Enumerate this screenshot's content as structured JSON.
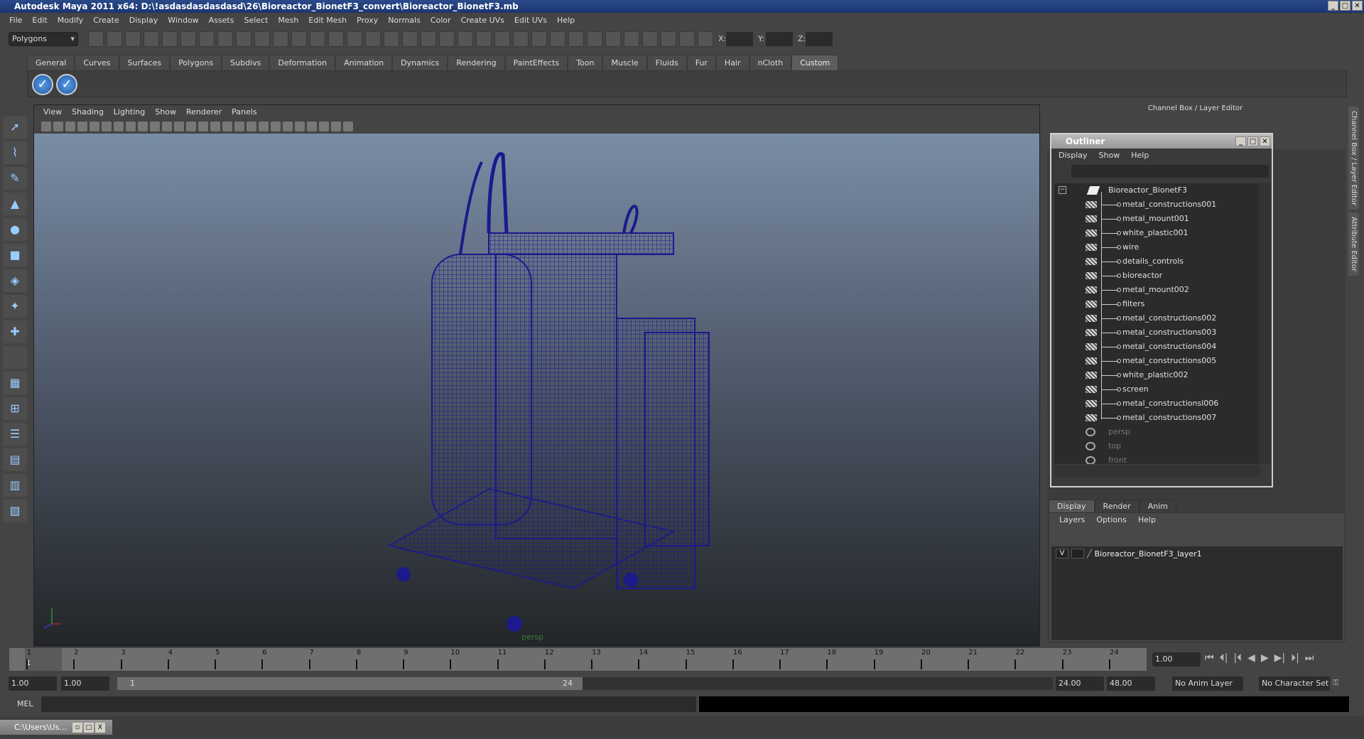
{
  "title": "Autodesk Maya 2011 x64: D:\\!asdasdasdasdasd\\26\\Bioreactor_BionetF3_convert\\Bioreactor_BionetF3.mb",
  "menu": [
    "File",
    "Edit",
    "Modify",
    "Create",
    "Display",
    "Window",
    "Assets",
    "Select",
    "Mesh",
    "Edit Mesh",
    "Proxy",
    "Normals",
    "Color",
    "Create UVs",
    "Edit UVs",
    "Help"
  ],
  "toolbar": {
    "mode": "Polygons",
    "x_label": "X:",
    "y_label": "Y:",
    "z_label": "Z:"
  },
  "shelf_tabs": [
    "General",
    "Curves",
    "Surfaces",
    "Polygons",
    "Subdivs",
    "Deformation",
    "Animation",
    "Dynamics",
    "Rendering",
    "PaintEffects",
    "Toon",
    "Muscle",
    "Fluids",
    "Fur",
    "Hair",
    "nCloth",
    "Custom"
  ],
  "shelf_active": "Custom",
  "viewport": {
    "menu": [
      "View",
      "Shading",
      "Lighting",
      "Show",
      "Renderer",
      "Panels"
    ],
    "camera": "persp",
    "wire_color": "#1a1a8c"
  },
  "channel_box_title": "Channel Box / Layer Editor",
  "outliner": {
    "title": "Outliner",
    "menu": [
      "Display",
      "Show",
      "Help"
    ],
    "root": "Bioreactor_BionetF3",
    "children": [
      "metal_constructions001",
      "metal_mount001",
      "white_plastic001",
      "wire",
      "details_controls",
      "bioreactor",
      "metal_mount002",
      "filters",
      "metal_constructions002",
      "metal_constructions003",
      "metal_constructions004",
      "metal_constructions005",
      "white_plastic002",
      "screen",
      "metal_constructionsl006",
      "metal_constructions007"
    ],
    "cameras": [
      "persp",
      "top",
      "front"
    ]
  },
  "layer_editor": {
    "tabs": [
      "Display",
      "Render",
      "Anim"
    ],
    "menu": [
      "Layers",
      "Options",
      "Help"
    ],
    "layer": {
      "visible": "V",
      "name": "Bioreactor_BionetF3_layer1"
    }
  },
  "side_tabs": [
    "Channel Box / Layer Editor",
    "Attribute Editor"
  ],
  "timeline": {
    "ticks": [
      "1",
      "2",
      "3",
      "4",
      "5",
      "6",
      "7",
      "8",
      "9",
      "10",
      "11",
      "12",
      "13",
      "14",
      "15",
      "16",
      "17",
      "18",
      "19",
      "20",
      "21",
      "22",
      "23",
      "24"
    ],
    "current": "1",
    "current_field": "1.00"
  },
  "range": {
    "start": "1.00",
    "playback_start": "1.00",
    "range_start": "1",
    "range_end": "24",
    "playback_end": "24.00",
    "end": "48.00",
    "anim_layer": "No Anim Layer",
    "char_set": "No Character Set"
  },
  "mel_label": "MEL",
  "taskbar": "C:\\Users\\Us..."
}
